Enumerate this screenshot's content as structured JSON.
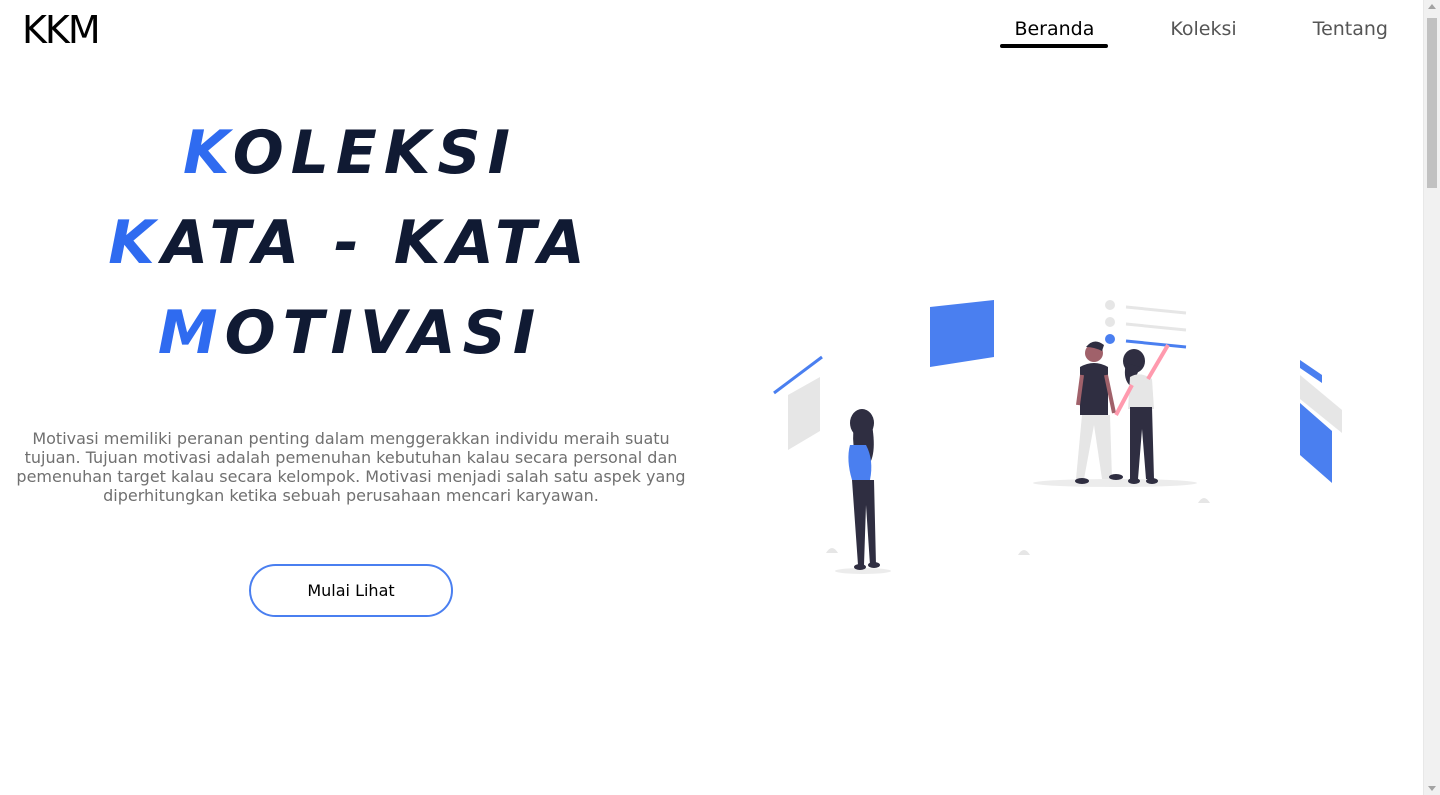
{
  "logo": "KKM",
  "nav": {
    "items": [
      {
        "label": "Beranda",
        "active": true
      },
      {
        "label": "Koleksi",
        "active": false
      },
      {
        "label": "Tentang",
        "active": false
      }
    ]
  },
  "hero": {
    "lines": [
      {
        "first": "K",
        "rest": "OLEKSI"
      },
      {
        "first": "K",
        "rest": "ATA - KATA"
      },
      {
        "first": "M",
        "rest": "OTIVASI"
      }
    ],
    "description": "Motivasi memiliki peranan penting dalam menggerakkan individu meraih suatu tujuan. Tujuan motivasi adalah pemenuhan kebutuhan kalau secara personal dan pemenuhan target kalau secara kelompok. Motivasi menjadi salah satu aspek yang diperhitungkan ketika sebuah perusahaan mencari karyawan.",
    "cta_label": "Mulai Lihat"
  },
  "colors": {
    "accent": "#2f6bf0",
    "title": "#101a33",
    "text_muted": "#707070",
    "illustration_blue": "#4a7ff0"
  },
  "illustration": {
    "icon": "people-with-checklist-illustration"
  }
}
